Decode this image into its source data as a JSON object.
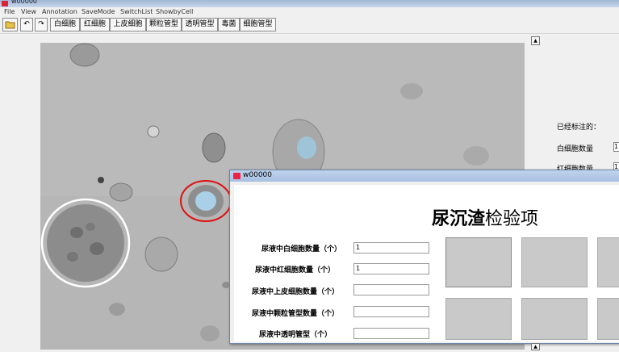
{
  "window": {
    "title": "w00000"
  },
  "menu": [
    "File",
    "View",
    "Annotation",
    "SaveMode",
    "SwitchList",
    "ShowbyCell"
  ],
  "toolbar": {
    "cell_buttons": [
      "白细胞",
      "红细胞",
      "上皮细胞",
      "颗粒管型",
      "透明管型",
      "毒菌",
      "细胞管型"
    ]
  },
  "sidebar": {
    "title": "已经标注的：",
    "items": [
      {
        "label": "白细胞数量",
        "value": "1"
      },
      {
        "label": "红细胞数量",
        "value": "1"
      }
    ]
  },
  "dialog": {
    "title": "w00000",
    "heading_bold": "尿沉渣",
    "heading_rest": "检验项",
    "fields": [
      {
        "label": "尿液中白细胞数量（个）",
        "value": "1"
      },
      {
        "label": "尿液中红细胞数量（个）",
        "value": "1"
      },
      {
        "label": "尿液中上皮细胞数量（个）",
        "value": ""
      },
      {
        "label": "尿液中颗粒管型数量（个）",
        "value": ""
      },
      {
        "label": "尿液中透明管型（个）",
        "value": ""
      }
    ]
  },
  "colors": {
    "annotation_white": "#ffffff",
    "annotation_red": "#dd1111",
    "title_bar": "#a8c0e2"
  }
}
